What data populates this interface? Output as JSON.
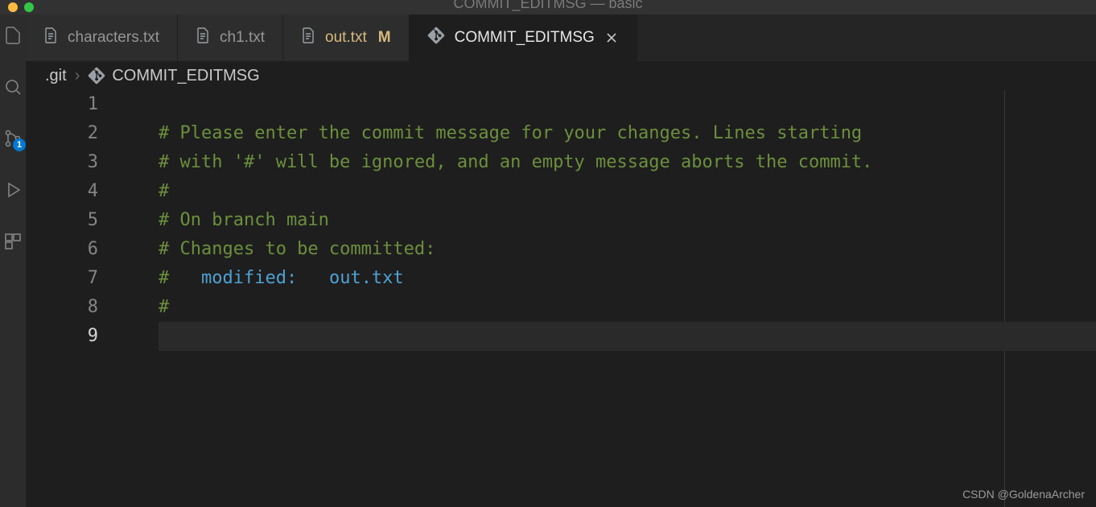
{
  "titlebar": {
    "text": "COMMIT_EDITMSG — basic"
  },
  "activity": {
    "scm_badge": "1"
  },
  "tabs": [
    {
      "label": "characters.txt",
      "modified": false,
      "active": false,
      "kind": "text"
    },
    {
      "label": "ch1.txt",
      "modified": false,
      "active": false,
      "kind": "text"
    },
    {
      "label": "out.txt",
      "modified": true,
      "active": false,
      "kind": "text",
      "mod_indicator": "M"
    },
    {
      "label": "COMMIT_EDITMSG",
      "modified": false,
      "active": true,
      "kind": "git"
    }
  ],
  "breadcrumb": {
    "segments": [
      {
        "label": ".git",
        "icon": "none"
      },
      {
        "label": "COMMIT_EDITMSG",
        "icon": "git"
      }
    ],
    "separator": "›"
  },
  "editor": {
    "cursor_line": 9,
    "lines": [
      {
        "n": 1,
        "plain": ""
      },
      {
        "n": 2,
        "comment": "# Please enter the commit message for your changes. Lines starting"
      },
      {
        "n": 3,
        "comment": "# with '#' will be ignored, and an empty message aborts the commit."
      },
      {
        "n": 4,
        "comment": "#"
      },
      {
        "n": 5,
        "comment": "# On branch main"
      },
      {
        "n": 6,
        "comment": "# Changes to be committed:"
      },
      {
        "n": 7,
        "comment_prefix": "#   ",
        "keyword": "modified:",
        "between": "   ",
        "file": "out.txt"
      },
      {
        "n": 8,
        "comment": "#"
      },
      {
        "n": 9,
        "plain": ""
      }
    ]
  },
  "watermark": "CSDN @GoldenaArcher"
}
